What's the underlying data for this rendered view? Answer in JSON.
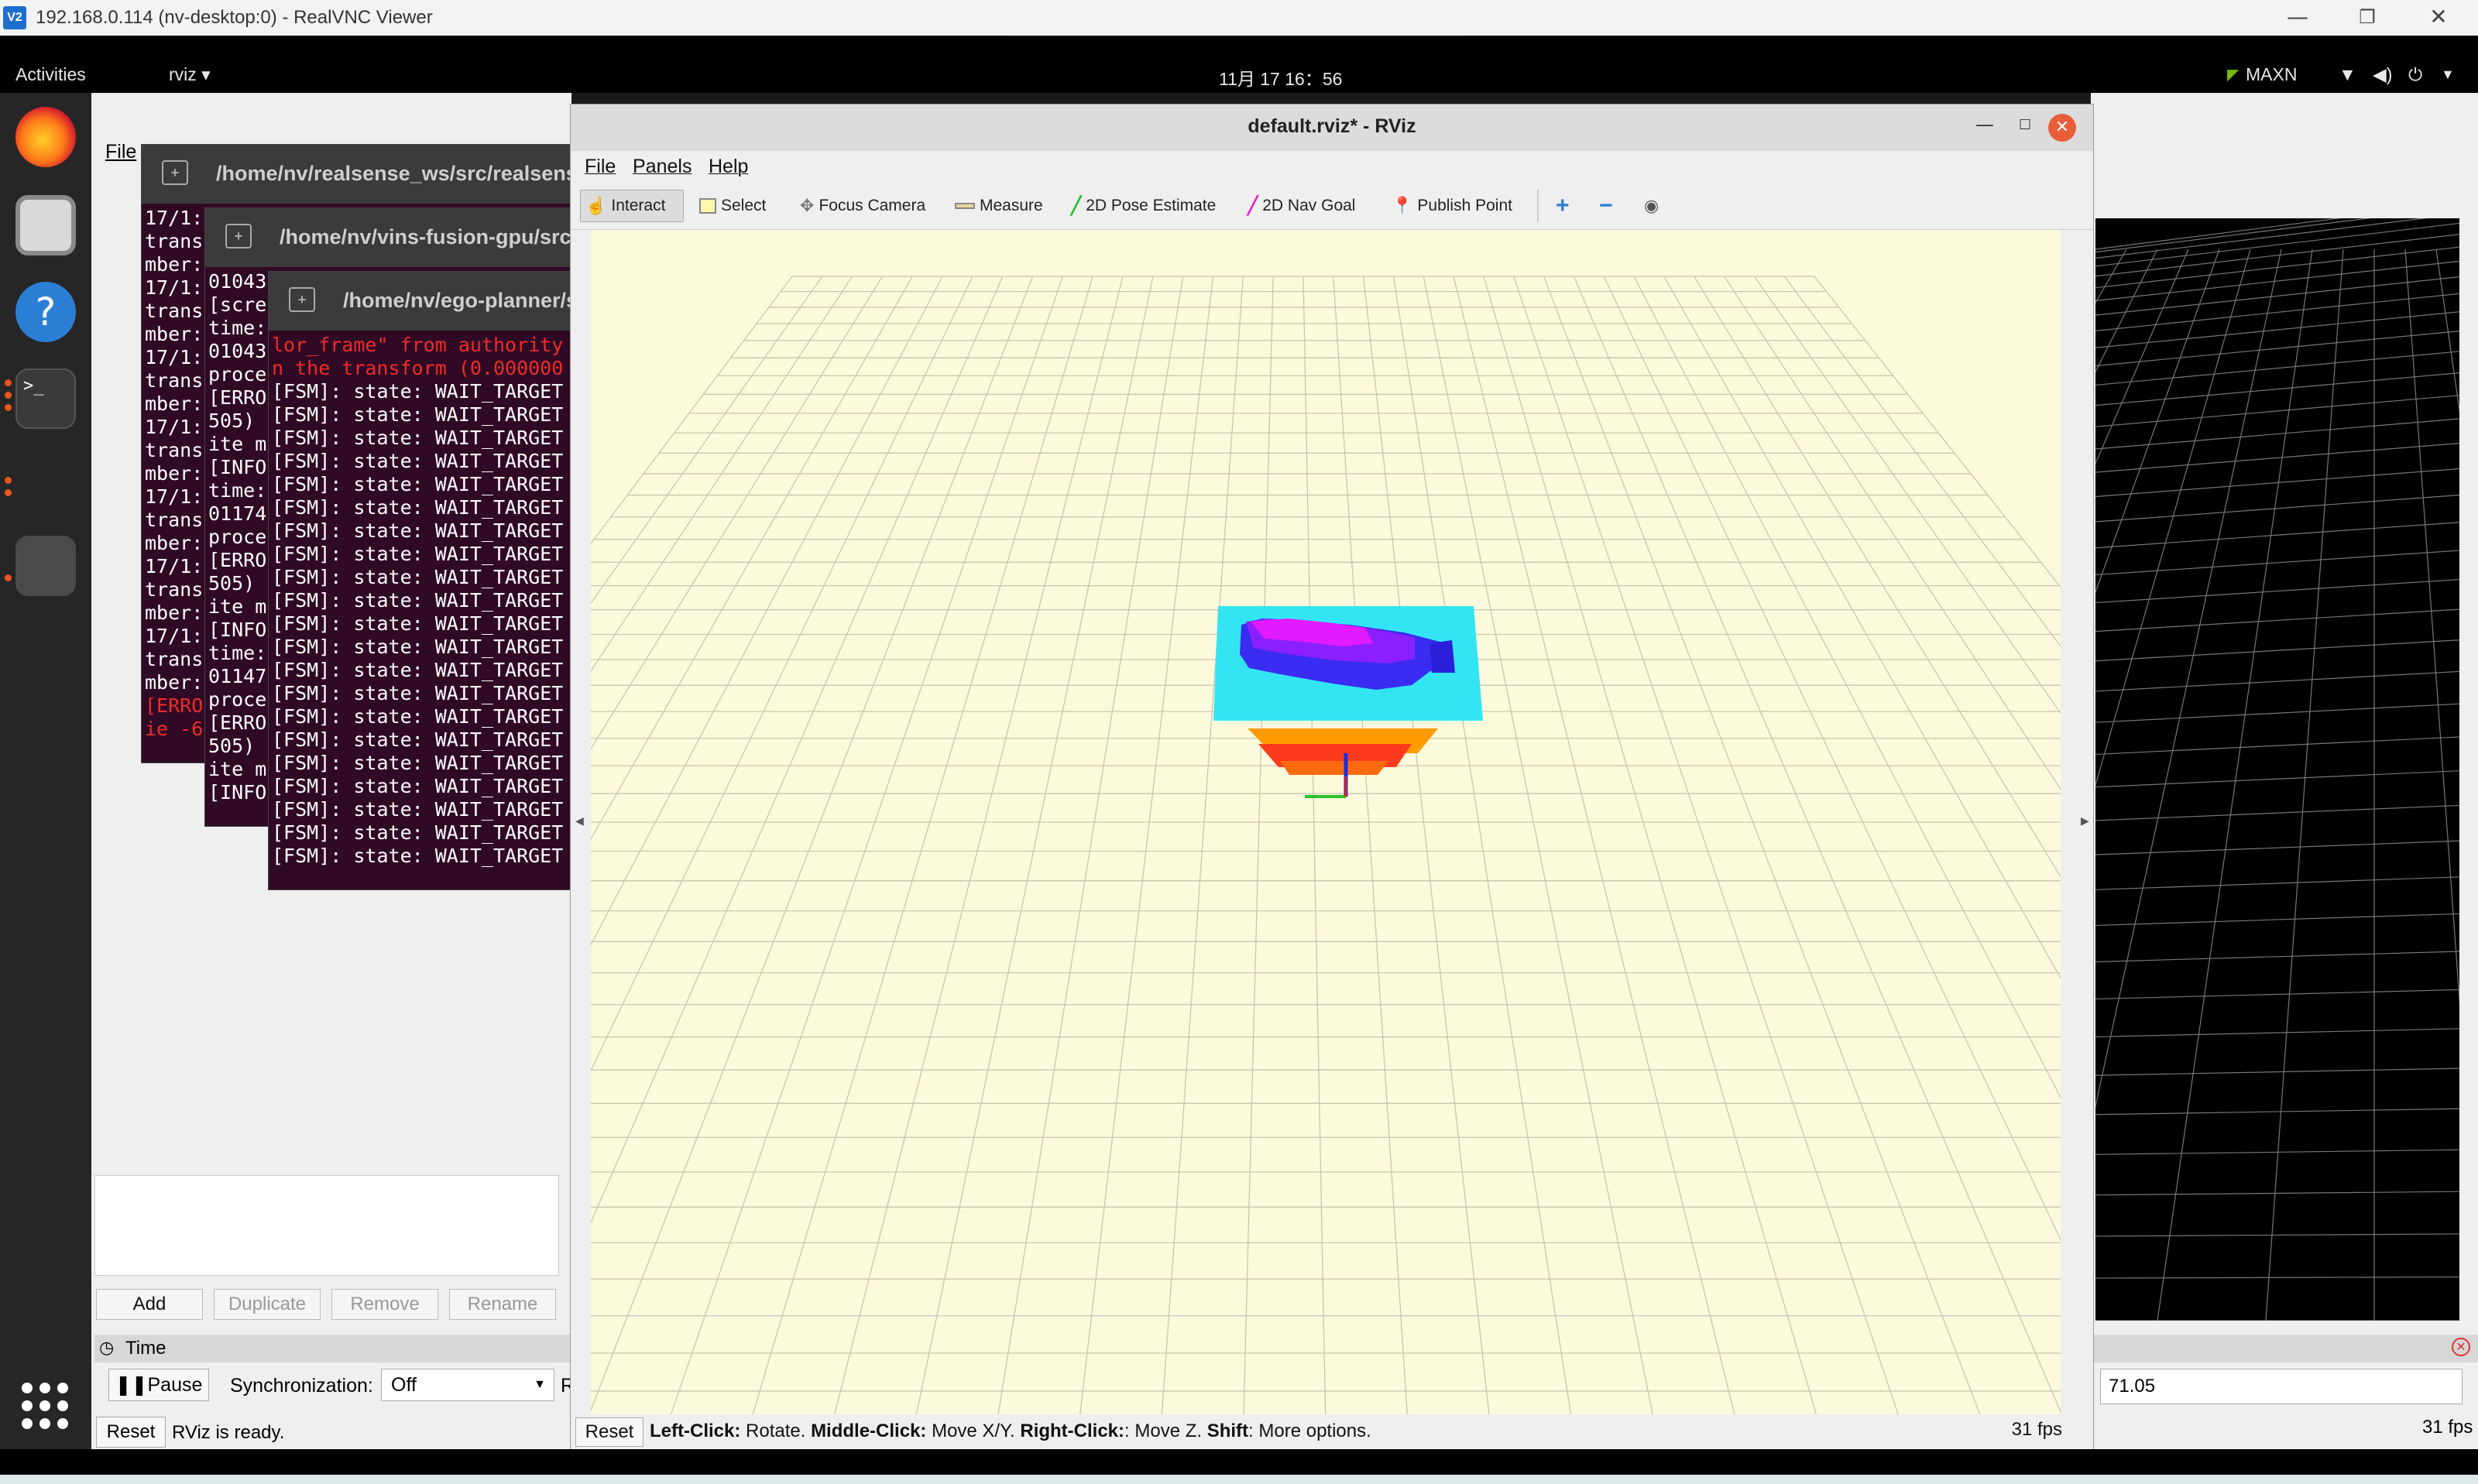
{
  "vnc": {
    "title": "192.168.0.114 (nv-desktop:0) - RealVNC Viewer",
    "logo": "V2",
    "minimize": "—",
    "restore": "❐",
    "close": "✕"
  },
  "gnome": {
    "activities": "Activities",
    "app_menu": "rviz ▾",
    "clock": "11月 17  16：56",
    "power_mode": "MAXN"
  },
  "terminals": [
    {
      "path": "/home/nv/realsense_ws/src/realsense",
      "lines": [
        "17/1:",
        "trans",
        "mber:",
        "17/1:",
        "trans",
        "mber:",
        "17/1:",
        "trans",
        "mber:",
        "17/1:",
        "trans",
        "mber:",
        "17/1:",
        "trans",
        "mber:",
        "17/1:",
        "trans",
        "mber:",
        "17/1:",
        "trans",
        "mber:",
        "[ERRO",
        "ie -6"
      ]
    },
    {
      "path": "/home/nv/vins-fusion-gpu/src/V",
      "lines": [
        "01043",
        "[scre",
        "time:",
        "01043",
        "proce",
        "[ERRO",
        "505) ",
        "ite m",
        "[INFO",
        "time:",
        "01174",
        "proce",
        "[ERRO",
        "505) ",
        "ite m",
        "[INFO",
        "time:",
        "01147",
        "proce",
        "[ERRO",
        "505) ",
        "ite m",
        "[INFO"
      ]
    },
    {
      "path": "/home/nv/ego-planner/s",
      "error_lines": [
        "lor_frame\" from authority",
        "n the transform (0.000000"
      ],
      "fsm_line": "[FSM]: state: WAIT_TARGET",
      "fsm_count": 21
    }
  ],
  "rviz": {
    "title": "default.rviz* - RViz",
    "menus": [
      "File",
      "Panels",
      "Help"
    ],
    "tools": [
      {
        "label": "Interact",
        "icon": "hand-icon"
      },
      {
        "label": "Select",
        "icon": "select-icon"
      },
      {
        "label": "Focus Camera",
        "icon": "focus-icon"
      },
      {
        "label": "Measure",
        "icon": "measure-icon"
      },
      {
        "label": "2D Pose Estimate",
        "icon": "pose-arrow-icon"
      },
      {
        "label": "2D Nav Goal",
        "icon": "goal-arrow-icon"
      },
      {
        "label": "Publish Point",
        "icon": "pin-icon"
      }
    ],
    "status": {
      "reset": "Reset",
      "hint_b1": "Left-Click:",
      "hint_t1": " Rotate. ",
      "hint_b2": "Middle-Click:",
      "hint_t2": " Move X/Y. ",
      "hint_b3": "Right-Click:",
      "hint_t3": ": Move Z. ",
      "hint_b4": "Shift",
      "hint_t4": ": More options.",
      "fps": "31 fps"
    },
    "colors": {
      "viewport_bg": "#fbfadc",
      "grid": "#c8c8c8",
      "close": "#e85d3a"
    }
  },
  "left_panel": {
    "menu_file": "File",
    "buttons": {
      "add": "Add",
      "duplicate": "Duplicate",
      "remove": "Remove",
      "rename": "Rename"
    },
    "time_title": "Time",
    "pause": "Pause",
    "sync_label": "Synchronization:",
    "sync_value": "Off",
    "r_label": "R",
    "reset": "Reset",
    "status": "RViz is ready."
  },
  "right_panel": {
    "input_prefix": ":",
    "input_value": "71.05",
    "fps": "31 fps"
  }
}
